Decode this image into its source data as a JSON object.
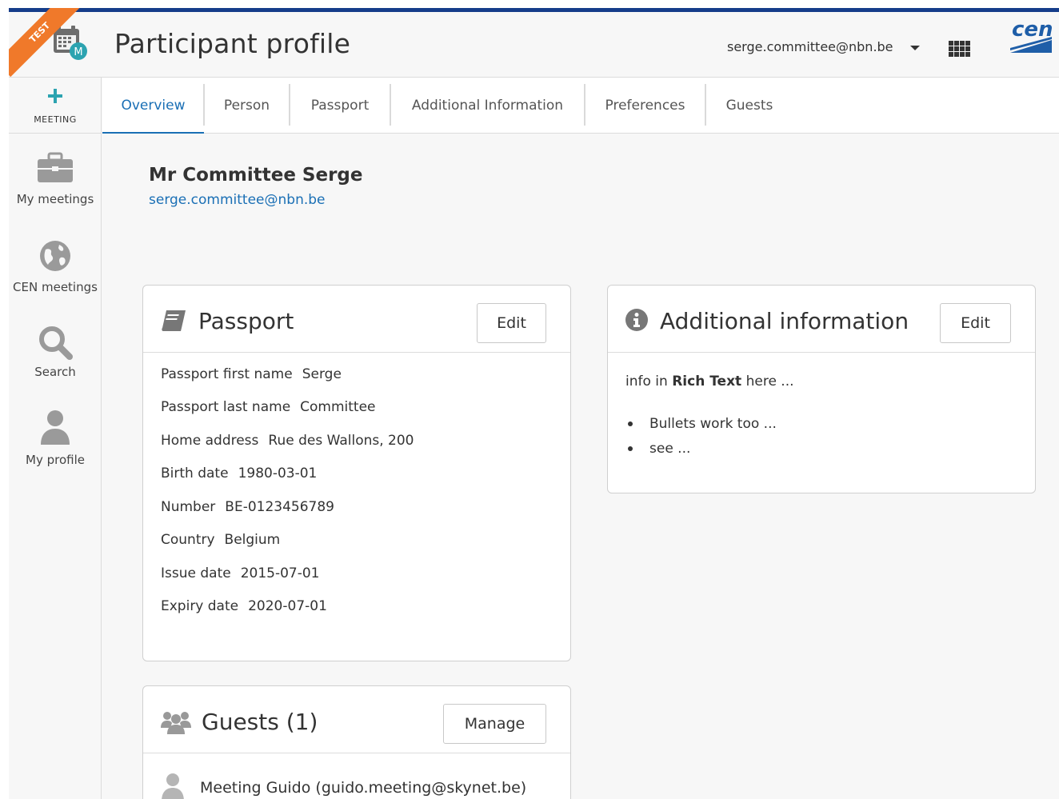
{
  "header": {
    "environment_badge": "TEST",
    "app_badge_letter": "M",
    "title": "Participant profile",
    "user_email": "serge.committee@nbn.be",
    "brand_logo_text": "cen"
  },
  "sidebar": {
    "meeting_label": "MEETING",
    "items": [
      {
        "label": "My meetings",
        "icon": "briefcase-icon"
      },
      {
        "label": "CEN meetings",
        "icon": "globe-icon"
      },
      {
        "label": "Search",
        "icon": "search-icon"
      },
      {
        "label": "My profile",
        "icon": "user-icon"
      }
    ]
  },
  "tabs": [
    {
      "label": "Overview",
      "active": true
    },
    {
      "label": "Person",
      "active": false
    },
    {
      "label": "Passport",
      "active": false
    },
    {
      "label": "Additional Information",
      "active": false
    },
    {
      "label": "Preferences",
      "active": false
    },
    {
      "label": "Guests",
      "active": false
    }
  ],
  "profile": {
    "name": "Mr Committee Serge",
    "email": "serge.committee@nbn.be"
  },
  "passport_card": {
    "title": "Passport",
    "edit_label": "Edit",
    "fields": [
      {
        "label": "Passport first name",
        "value": "Serge"
      },
      {
        "label": "Passport last name",
        "value": "Committee"
      },
      {
        "label": "Home address",
        "value": "Rue des Wallons, 200"
      },
      {
        "label": "Birth date",
        "value": "1980-03-01"
      },
      {
        "label": "Number",
        "value": "BE-0123456789"
      },
      {
        "label": "Country",
        "value": "Belgium"
      },
      {
        "label": "Issue date",
        "value": "2015-07-01"
      },
      {
        "label": "Expiry date",
        "value": "2020-07-01"
      }
    ]
  },
  "additional_card": {
    "title": "Additional information",
    "edit_label": "Edit",
    "text_before": "info in ",
    "text_bold": "Rich Text",
    "text_after": " here ...",
    "bullets": [
      "Bullets work too ...",
      "see ..."
    ]
  },
  "guests_card": {
    "title": "Guests (1)",
    "manage_label": "Manage",
    "guests": [
      "Meeting Guido (guido.meeting@skynet.be)"
    ]
  },
  "colors": {
    "accent": "#1a6fb5",
    "top_bar": "#153d8a",
    "test_ribbon": "#f0792a",
    "plus_icon": "#2ca3b0",
    "sidebar_icon": "#999999"
  }
}
